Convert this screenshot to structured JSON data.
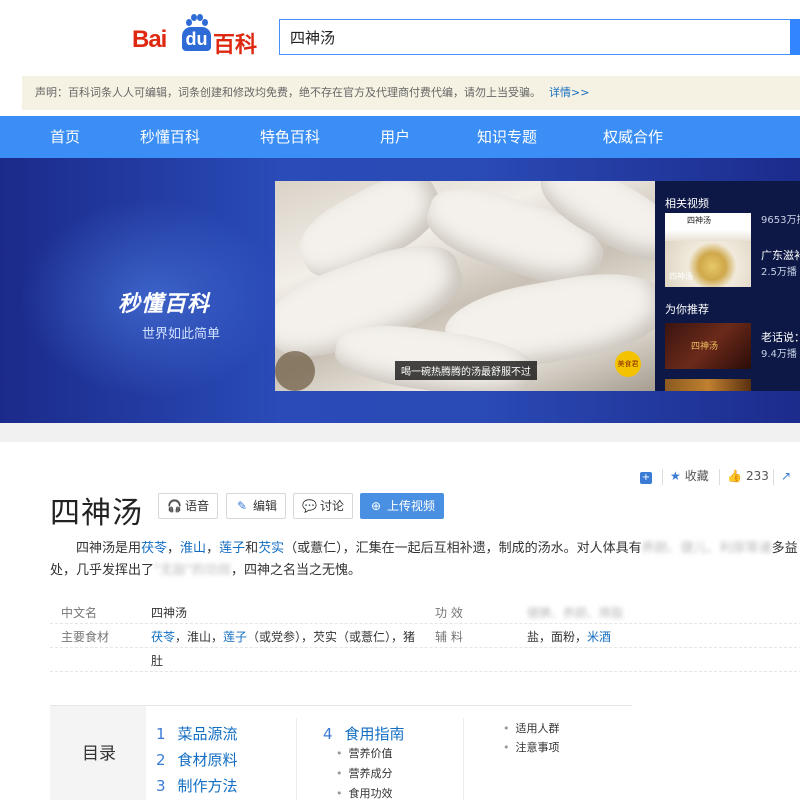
{
  "header": {
    "logo_bai": "Bai",
    "logo_du": "du",
    "logo_baike": "百科",
    "search_value": "四神汤"
  },
  "notice": {
    "text": "声明：百科词条人人可编辑，词条创建和修改均免费，绝不存在官方及代理商付费代编，请勿上当受骗。",
    "link": "详情>>"
  },
  "nav": {
    "items": [
      "首页",
      "秒懂百科",
      "特色百科",
      "用户",
      "知识专题",
      "权威合作"
    ]
  },
  "banner": {
    "brand": "秒懂百科",
    "slogan": "世界如此简单",
    "video_caption": "喝一碗热腾腾的汤最舒服不过",
    "video_badge": "美食君",
    "related_header": "相关视频",
    "recommend_header": "为你推荐",
    "related": [
      {
        "title": "",
        "plays": "9653万播"
      },
      {
        "title": "广东滋补",
        "plays": "2.5万播"
      }
    ],
    "recommend": [
      {
        "title": "老话说：",
        "plays": "9.4万播"
      }
    ],
    "thumb_text_1": "四神汤",
    "thumb_text_2": "四神汤",
    "thumb_text_3": "四神汤"
  },
  "entry": {
    "title": "四神汤",
    "buttons": {
      "voice": "语音",
      "edit": "编辑",
      "discuss": "讨论",
      "upload": "上传视频"
    },
    "tools": {
      "favorite": "收藏",
      "likes": "233"
    },
    "summary": {
      "p1": "四神汤是用",
      "l1": "茯苓",
      "s1": "，",
      "l2": "淮山",
      "s2": "，",
      "l3": "莲子",
      "s3": "和",
      "l4": "芡实",
      "p2": "（或薏仁），汇集在一起后互相补遗，制成的汤水。对人体具有",
      "blur1": "养颜、健儿、利尿等诸",
      "p3": "多益处，几乎发挥出了",
      "blur2": "\"无敌\"的功效",
      "p4": "，四神之名当之无愧。"
    },
    "info": {
      "row1": {
        "k1": "中文名",
        "v1": "四神汤",
        "k2": "功  效",
        "v2": "健脾、养颜、降脂"
      },
      "row2": {
        "k1": "主要食材",
        "v1a": "茯苓",
        "v1b": "，淮山，",
        "v1c": "莲子",
        "v1d": "（或党参），芡实（或薏仁），猪",
        "k2": "辅  料",
        "v2a": "盐，面粉，",
        "v2b": "米酒"
      },
      "row3": {
        "v1": "肚"
      }
    },
    "toc": {
      "label": "目录",
      "items": [
        {
          "n": "1",
          "label": "菜品源流"
        },
        {
          "n": "2",
          "label": "食材原料"
        },
        {
          "n": "3",
          "label": "制作方法"
        },
        {
          "n": "4",
          "label": "食用指南"
        }
      ],
      "subs_4": [
        "营养价值",
        "营养成分",
        "食用功效"
      ],
      "subs_right": [
        "适用人群",
        "注意事项"
      ]
    }
  },
  "colors": {
    "brand_red": "#de2910",
    "brand_blue": "#2e6bd7",
    "nav_blue": "#3a8ef5",
    "link_blue": "#136ec2"
  }
}
